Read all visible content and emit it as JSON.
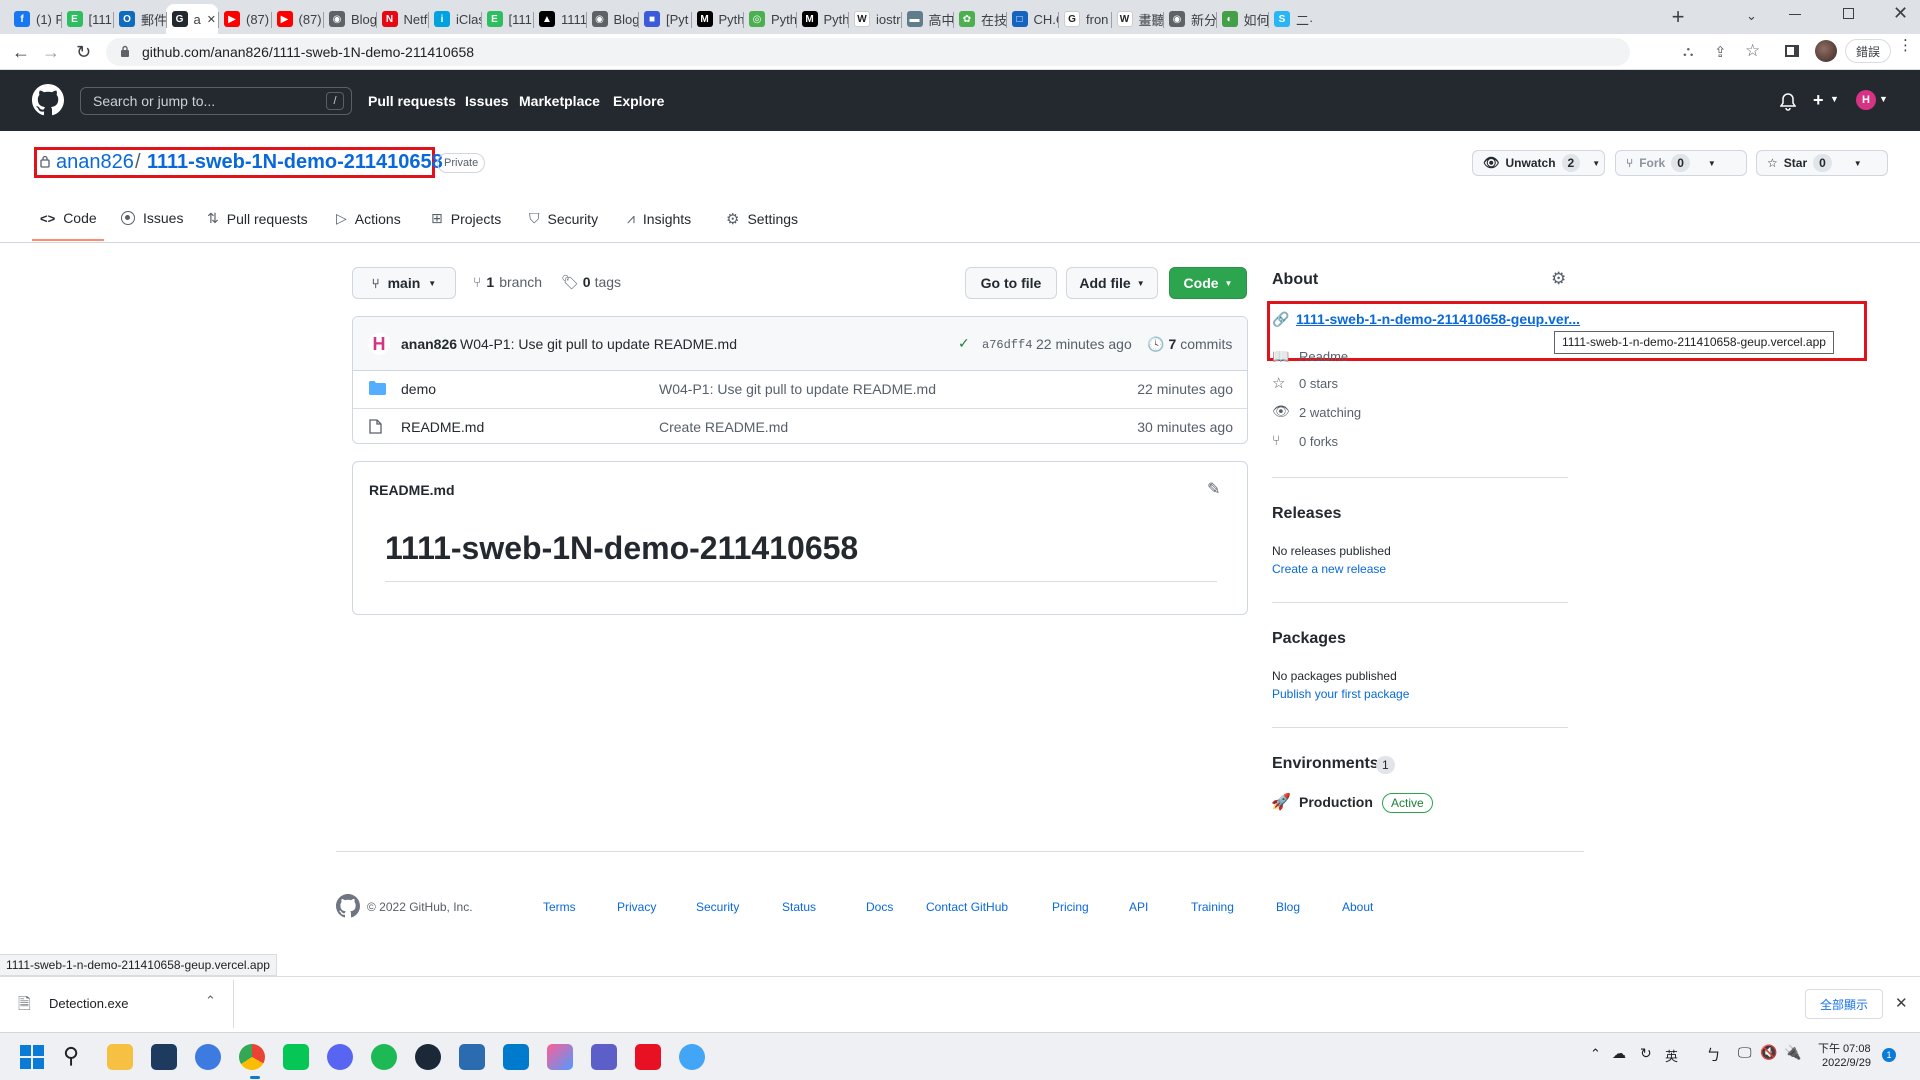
{
  "browser": {
    "tabs": [
      {
        "label": "(1) F",
        "color": "#1877f2",
        "glyph": "f"
      },
      {
        "label": "[111",
        "color": "#2dbe60",
        "glyph": "E"
      },
      {
        "label": "郵件",
        "color": "#0f6cbd",
        "glyph": "O"
      },
      {
        "label": "a",
        "color": "#24292f",
        "glyph": "G",
        "active": true
      },
      {
        "label": "(87)",
        "color": "#ff0000",
        "glyph": "▶"
      },
      {
        "label": "(87)",
        "color": "#ff0000",
        "glyph": "▶"
      },
      {
        "label": "Blog",
        "color": "#5f6368",
        "glyph": "◉"
      },
      {
        "label": "Netf",
        "color": "#e50914",
        "glyph": "N"
      },
      {
        "label": "iClas",
        "color": "#00a3e0",
        "glyph": "i"
      },
      {
        "label": "[111",
        "color": "#2dbe60",
        "glyph": "E"
      },
      {
        "label": "1111",
        "color": "#000000",
        "glyph": "▲"
      },
      {
        "label": "Blog",
        "color": "#5f6368",
        "glyph": "◉"
      },
      {
        "label": "[Pyt",
        "color": "#3b5bdb",
        "glyph": "■"
      },
      {
        "label": "Pyth",
        "color": "#000000",
        "glyph": "M"
      },
      {
        "label": "Pyth",
        "color": "#4caf50",
        "glyph": "◎"
      },
      {
        "label": "Pyth",
        "color": "#000000",
        "glyph": "M"
      },
      {
        "label": "iostr",
        "color": "#ffffff",
        "glyph": "W"
      },
      {
        "label": "高中",
        "color": "#607d8b",
        "glyph": "▬"
      },
      {
        "label": "在技",
        "color": "#4caf50",
        "glyph": "✿"
      },
      {
        "label": "CH.C",
        "color": "#1565c0",
        "glyph": "□"
      },
      {
        "label": "fron",
        "color": "#ffffff",
        "glyph": "G"
      },
      {
        "label": "畫聽",
        "color": "#ffffff",
        "glyph": "W"
      },
      {
        "label": "新分",
        "color": "#5f6368",
        "glyph": "◉"
      },
      {
        "label": "如何",
        "color": "#43a047",
        "glyph": "◐"
      },
      {
        "label": "二·",
        "color": "#29b6f6",
        "glyph": "S"
      }
    ],
    "new_tab_symbol": "+",
    "url": "github.com/anan826/1111-sweb-1N-demo-211410658",
    "profile_button": "錯誤"
  },
  "github": {
    "search_placeholder": "Search or jump to...",
    "search_kbd": "/",
    "nav": [
      "Pull requests",
      "Issues",
      "Marketplace",
      "Explore"
    ],
    "repo": {
      "owner": "anan826",
      "separator": "/",
      "name": "1111-sweb-1N-demo-211410658",
      "visibility": "Private",
      "unwatch_label": "Unwatch",
      "watch_count": "2",
      "fork_label": "Fork",
      "fork_count": "0",
      "star_label": "Star",
      "star_count": "0"
    },
    "tabs": [
      "Code",
      "Issues",
      "Pull requests",
      "Actions",
      "Projects",
      "Security",
      "Insights",
      "Settings"
    ],
    "file_nav": {
      "branch": "main",
      "branch_count": "1",
      "branch_word": "branch",
      "tag_count": "0",
      "tag_word": "tags",
      "go_to_file": "Go to file",
      "add_file": "Add file",
      "code": "Code"
    },
    "commit": {
      "author": "anan826",
      "message": "W04-P1: Use git pull to update README.md",
      "sha": "a76dff4",
      "time": "22 minutes ago",
      "commits_count": "7",
      "commits_word": "commits"
    },
    "files": [
      {
        "name": "demo",
        "type": "folder",
        "message": "W04-P1: Use git pull to update README.md",
        "time": "22 minutes ago"
      },
      {
        "name": "README.md",
        "type": "file",
        "message": "Create README.md",
        "time": "30 minutes ago"
      }
    ],
    "readme": {
      "filename": "README.md",
      "heading": "1111-sweb-1N-demo-211410658"
    },
    "about": {
      "title": "About",
      "website": "1111-sweb-1-n-demo-211410658-geup.ver...",
      "tooltip": "1111-sweb-1-n-demo-211410658-geup.vercel.app",
      "readme_label": "Readme",
      "stars": "0 stars",
      "watching": "2 watching",
      "forks": "0 forks"
    },
    "releases": {
      "title": "Releases",
      "empty": "No releases published",
      "create": "Create a new release"
    },
    "packages": {
      "title": "Packages",
      "empty": "No packages published",
      "publish": "Publish your first package"
    },
    "environments": {
      "title": "Environments",
      "count": "1",
      "name": "Production",
      "status": "Active"
    },
    "footer": {
      "copyright": "© 2022 GitHub, Inc.",
      "links": [
        "Terms",
        "Privacy",
        "Security",
        "Status",
        "Docs",
        "Contact GitHub",
        "Pricing",
        "API",
        "Training",
        "Blog",
        "About"
      ]
    }
  },
  "status_url": "1111-sweb-1-n-demo-211410658-geup.vercel.app",
  "download": {
    "filename": "Detection.exe",
    "show_all": "全部顯示",
    "close": "✕"
  },
  "taskbar": {
    "time": "下午 07:08",
    "date": "2022/9/29",
    "ime": "英",
    "notification_count": "1"
  },
  "colors": {
    "github_header": "#24292f",
    "primary_green": "#2da44e",
    "link_blue": "#0969da",
    "annotation_red": "#e0121a"
  }
}
